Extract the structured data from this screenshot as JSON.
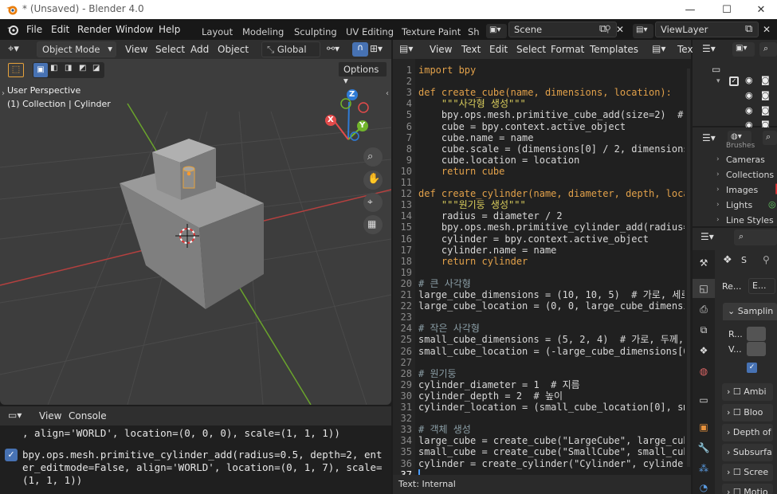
{
  "window": {
    "title": "* (Unsaved) - Blender 4.0",
    "min": "—",
    "max": "☐",
    "close": "✕"
  },
  "menu": [
    "File",
    "Edit",
    "Render",
    "Window",
    "Help"
  ],
  "workspaces": [
    "Layout",
    "Modeling",
    "Sculpting",
    "UV Editing",
    "Texture Paint",
    "Sh"
  ],
  "scene": {
    "name": "Scene",
    "viewlayer": "ViewLayer"
  },
  "viewport": {
    "mode": "Object Mode",
    "menus": [
      "View",
      "Select",
      "Add",
      "Object"
    ],
    "transform": "Global",
    "options": "Options",
    "overlay_title": "User Perspective",
    "overlay_sub": "(1) Collection | Cylinder",
    "gizmo": {
      "x": "X",
      "y": "Y",
      "z": "Z"
    }
  },
  "console": {
    "menus": [
      "View",
      "Console"
    ],
    "lines": [
      ", align='WORLD', location=(0, 0, 0), scale=(1, 1, 1))",
      "bpy.ops.mesh.primitive_cylinder_add(radius=0.5, depth=2, ent",
      "er_editmode=False, align='WORLD', location=(0, 1, 7), scale=",
      "(1, 1, 1))"
    ]
  },
  "text_editor": {
    "menus": [
      "View",
      "Text",
      "Edit",
      "Select",
      "Format",
      "Templates"
    ],
    "tab_name": "Tex",
    "footer": "Text: Internal",
    "current_line": "37",
    "lines": [
      "import bpy",
      "",
      "def create_cube(name, dimensions, location):",
      "    \"\"\"사각형 생성\"\"\"",
      "    bpy.ops.mesh.primitive_cube_add(size=2)  # 기본",
      "    cube = bpy.context.active_object",
      "    cube.name = name",
      "    cube.scale = (dimensions[0] / 2, dimensions[1]",
      "    cube.location = location",
      "    return cube",
      "",
      "def create_cylinder(name, diameter, depth, location",
      "    \"\"\"원기둥 생성\"\"\"",
      "    radius = diameter / 2",
      "    bpy.ops.mesh.primitive_cylinder_add(radius=radi",
      "    cylinder = bpy.context.active_object",
      "    cylinder.name = name",
      "    return cylinder",
      "",
      "# 큰 사각형",
      "large_cube_dimensions = (10, 10, 5)  # 가로, 세로,",
      "large_cube_location = (0, 0, large_cube_dimensions[",
      "",
      "# 작은 사각형",
      "small_cube_dimensions = (5, 2, 4)  # 가로, 두께, 높",
      "small_cube_location = (-large_cube_dimensions[0] /",
      "",
      "# 원기둥",
      "cylinder_diameter = 1  # 지름",
      "cylinder_depth = 2  # 높이",
      "cylinder_location = (small_cube_location[0], small_",
      "",
      "# 객체 생성",
      "large_cube = create_cube(\"LargeCube\", large_cube_di",
      "small_cube = create_cube(\"SmallCube\", small_cube_di",
      "cylinder = create_cylinder(\"Cylinder\", cylinder_dia",
      ""
    ]
  },
  "outliner": {
    "items": [
      "Brushes",
      "Cameras",
      "Collections",
      "Images",
      "Lights",
      "Line Styles"
    ]
  },
  "properties": {
    "header_s": "S",
    "render_label": "Re...",
    "engine": "E...",
    "sampling": "Samplin",
    "r_label": "R...",
    "v_label": "V...",
    "sections": [
      "Ambi",
      "Bloo",
      "Depth of",
      "Subsurfa",
      "Scree",
      "Motio"
    ]
  },
  "colors": {
    "accent": "#4772b3",
    "x_axis": "#e34b4b",
    "y_axis": "#72b52c",
    "z_axis": "#2f7bd6",
    "keyword": "#e2a14a",
    "string": "#d9cc5c",
    "comment": "#8a9da5",
    "func": "#e0b0ff"
  }
}
